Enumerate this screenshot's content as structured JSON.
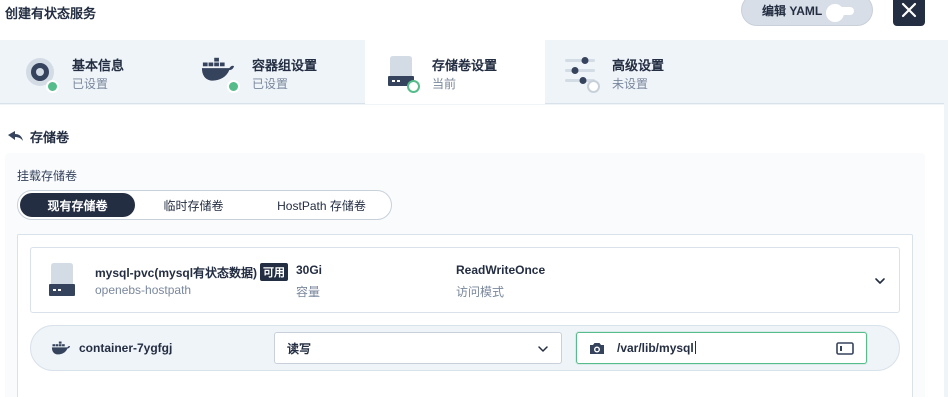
{
  "header": {
    "title": "创建有状态服务",
    "yaml_label": "编辑 YAML"
  },
  "tabs": [
    {
      "title": "基本信息",
      "sub": "已设置",
      "icon": "info-disc-icon",
      "status_color": "#55bc8a"
    },
    {
      "title": "容器组设置",
      "sub": "已设置",
      "icon": "docker-whale-icon",
      "status_color": "#55bc8a"
    },
    {
      "title": "存储卷设置",
      "sub": "当前",
      "icon": "storage-disk-icon",
      "status_color": "#ffffff"
    },
    {
      "title": "高级设置",
      "sub": "未设置",
      "icon": "sliders-icon",
      "status_color": "#ffffff"
    }
  ],
  "back": {
    "label": "存储卷"
  },
  "mount": {
    "label": "挂载存储卷",
    "options": [
      "现有存储卷",
      "临时存储卷",
      "HostPath 存储卷"
    ],
    "selected": "现有存储卷"
  },
  "volume": {
    "name": "mysql-pvc(mysql有状态数据)",
    "badge": "可用",
    "storage_class": "openebs-hostpath",
    "capacity": "30Gi",
    "capacity_label": "容量",
    "access_mode": "ReadWriteOnce",
    "access_mode_label": "访问模式"
  },
  "container_mount": {
    "container": "container-7ygfgj",
    "permission": "读写",
    "mount_path": "/var/lib/mysql"
  },
  "colors": {
    "accent_green": "#55bc8a",
    "dark": "#242e42",
    "muted": "#79879c"
  }
}
